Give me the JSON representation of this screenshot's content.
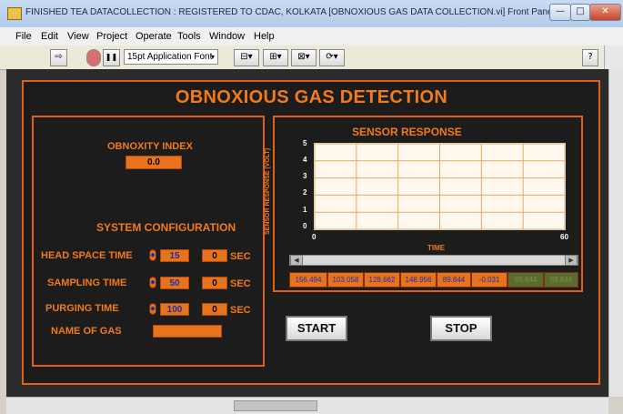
{
  "window": {
    "title": "FINISHED TEA DATACOLLECTION  : REGISTERED TO  CDAC, KOLKATA [OBNOXIOUS GAS DATA COLLECTION.vi] Front Panel",
    "min_label": "—",
    "max_label": "□",
    "close_label": "✕"
  },
  "menu": [
    "File",
    "Edit",
    "View",
    "Project",
    "Operate",
    "Tools",
    "Window",
    "Help"
  ],
  "toolbar": {
    "run_icon": "⇨",
    "pause_icon": "❚❚",
    "font_select": "15pt Application Font",
    "help_icon": "?"
  },
  "panel": {
    "title": "OBNOXIOUS GAS DETECTION",
    "obnoxity_label": "OBNOXITY INDEX",
    "obnoxity_value": "0.0",
    "config_label": "SYSTEM CONFIGURATION",
    "rows": [
      {
        "label": "HEAD SPACE TIME",
        "value": "15",
        "readout": "0",
        "unit": "SEC"
      },
      {
        "label": "SAMPLING TIME",
        "value": "50",
        "readout": "0",
        "unit": "SEC"
      },
      {
        "label": "PURGING TIME",
        "value": "100",
        "readout": "0",
        "unit": "SEC"
      }
    ],
    "gas_label": "NAME OF GAS",
    "gas_value": ""
  },
  "chart": {
    "title": "SENSOR RESPONSE",
    "ylabel": "SENSOR RESPONSE (VOLT)",
    "xlabel": "TIME",
    "y_ticks": [
      "5",
      "4",
      "3",
      "2",
      "1",
      "0"
    ],
    "x_ticks": [
      "0",
      "60"
    ]
  },
  "chart_data": {
    "type": "line",
    "title": "SENSOR RESPONSE",
    "xlabel": "TIME",
    "ylabel": "SENSOR RESPONSE (VOLT)",
    "xlim": [
      0,
      60
    ],
    "ylim": [
      0,
      5
    ],
    "grid": true,
    "series": []
  },
  "sensor_values": [
    "156.494",
    "103.058",
    "128.662",
    "148.956",
    "89.844",
    "-0.031",
    "89.844",
    "89.844"
  ],
  "buttons": {
    "start": "START",
    "stop": "STOP"
  },
  "colors": {
    "accent": "#e0601a",
    "panel_bg": "#1c1c1c",
    "field": "#e8731f",
    "value_text": "#1d2fa5"
  }
}
